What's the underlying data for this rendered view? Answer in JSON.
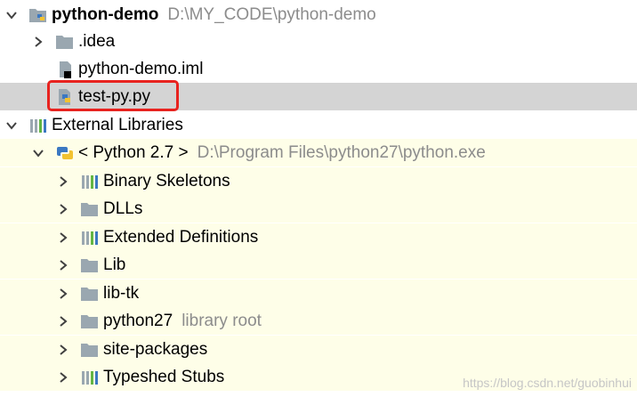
{
  "project": {
    "name": "python-demo",
    "path": "D:\\MY_CODE\\python-demo",
    "children": [
      {
        "label": ".idea"
      },
      {
        "label": "python-demo.iml"
      },
      {
        "label": "test-py.py"
      }
    ]
  },
  "external_libraries": {
    "label": "External Libraries",
    "sdk": {
      "label": "< Python 2.7 >",
      "path": "D:\\Program Files\\python27\\python.exe",
      "items": [
        {
          "label": "Binary Skeletons"
        },
        {
          "label": "DLLs"
        },
        {
          "label": "Extended Definitions"
        },
        {
          "label": "Lib"
        },
        {
          "label": "lib-tk"
        },
        {
          "label": "python27",
          "hint": "library root"
        },
        {
          "label": "site-packages"
        },
        {
          "label": "Typeshed Stubs"
        }
      ]
    }
  },
  "watermark": "https://blog.csdn.net/guobinhui",
  "colors": {
    "selection": "#d4d4d4",
    "library_background": "#fefee8",
    "highlight_border": "#e8231f",
    "path_text": "#8c8c8c"
  }
}
